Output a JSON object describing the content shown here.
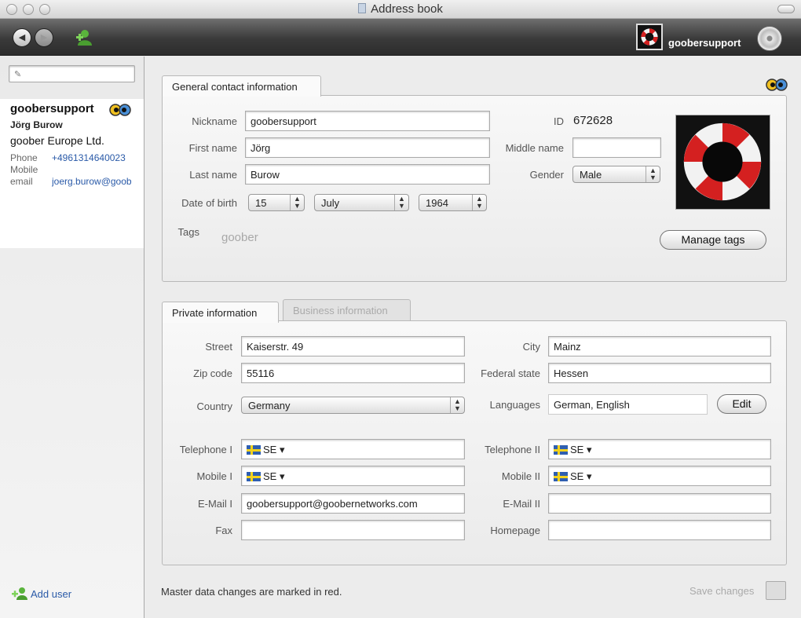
{
  "window": {
    "title": "Address book"
  },
  "toolbar": {
    "user_name": "goobersupport"
  },
  "sidebar": {
    "search_placeholder": "",
    "contact": {
      "nickname": "goobersupport",
      "full_name": "Jörg Burow",
      "company": "goober Europe Ltd.",
      "rows": [
        {
          "label": "Phone",
          "value": "+4961314640023"
        },
        {
          "label": "Mobile",
          "value": ""
        },
        {
          "label": "email",
          "value": "joerg.burow@goob"
        }
      ]
    },
    "add_user_label": "Add user"
  },
  "general": {
    "tab_label": "General contact information",
    "nickname_label": "Nickname",
    "nickname_value": "goobersupport",
    "first_name_label": "First name",
    "first_name_value": "Jörg",
    "last_name_label": "Last name",
    "last_name_value": "Burow",
    "dob_label": "Date of birth",
    "dob_day": "15",
    "dob_month": "July",
    "dob_year": "1964",
    "id_label": "ID",
    "id_value": "672628",
    "middle_name_label": "Middle name",
    "middle_name_value": "",
    "gender_label": "Gender",
    "gender_value": "Male",
    "tags_label": "Tags",
    "tags_value": "goober",
    "manage_tags_label": "Manage tags"
  },
  "details": {
    "tabs": [
      {
        "label": "Private information",
        "active": true
      },
      {
        "label": "Business information",
        "active": false
      }
    ],
    "street_label": "Street",
    "street_value": "Kaiserstr. 49",
    "zip_label": "Zip code",
    "zip_value": "55116",
    "country_label": "Country",
    "country_value": "Germany",
    "city_label": "City",
    "city_value": "Mainz",
    "state_label": "Federal state",
    "state_value": "Hessen",
    "languages_label": "Languages",
    "languages_value": "German, English",
    "edit_label": "Edit",
    "telephone1_label": "Telephone I",
    "telephone1_cc": "SE ▾",
    "telephone2_label": "Telephone II",
    "telephone2_cc": "SE ▾",
    "mobile1_label": "Mobile I",
    "mobile1_cc": "SE ▾",
    "mobile2_label": "Mobile II",
    "mobile2_cc": "SE ▾",
    "email1_label": "E-Mail I",
    "email1_value": "goobersupport@goobernetworks.com",
    "email2_label": "E-Mail II",
    "email2_value": "",
    "fax_label": "Fax",
    "fax_value": "",
    "homepage_label": "Homepage",
    "homepage_value": ""
  },
  "footer": {
    "note": "Master data changes are marked in red.",
    "save_label": "Save changes"
  },
  "colors": {
    "accent_link": "#2a5aa8",
    "toolbar_dark": "#2c2c2c",
    "lifebuoy_red": "#d42020"
  }
}
